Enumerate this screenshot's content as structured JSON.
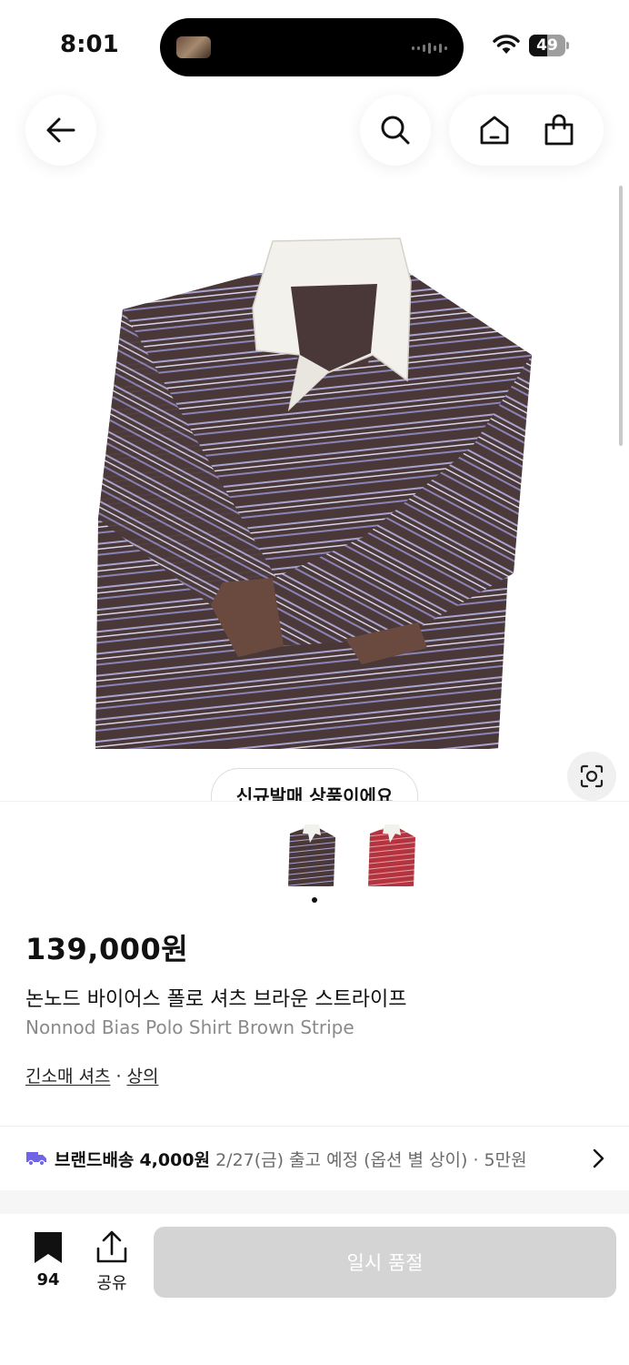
{
  "status_bar": {
    "time": "8:01",
    "battery_level": "49",
    "battery_fraction": 0.49
  },
  "nav": {
    "icons": [
      "back-arrow-icon",
      "search-icon",
      "home-icon",
      "shopping-bag-icon"
    ]
  },
  "product": {
    "badge": "신규발매 상품이에요",
    "thumbnail_colors": [
      "brown",
      "red"
    ],
    "selected_thumbnail": 0,
    "price": "139,000원",
    "name_ko": "논노드 바이어스 폴로 셔츠 브라운 스트라이프",
    "name_en": "Nonnod Bias Polo Shirt Brown Stripe",
    "categories": [
      "긴소매 셔츠",
      "상의"
    ],
    "category_separator": "·"
  },
  "shipping": {
    "label": "브랜드배송",
    "fee": "4,000원",
    "detail": "2/27(금) 출고 예정 (옵션 별 상이) · 5만원"
  },
  "bottom_bar": {
    "bookmark_count": "94",
    "share_label": "공유",
    "cta_label": "일시 품절"
  },
  "colors": {
    "shirt_brown": "#4a3838",
    "stripe_blue": "#a9a4cf",
    "shirt_red": "#b3343f",
    "truck_icon": "#6f63e6",
    "cta_disabled": "#d4d4d4"
  }
}
